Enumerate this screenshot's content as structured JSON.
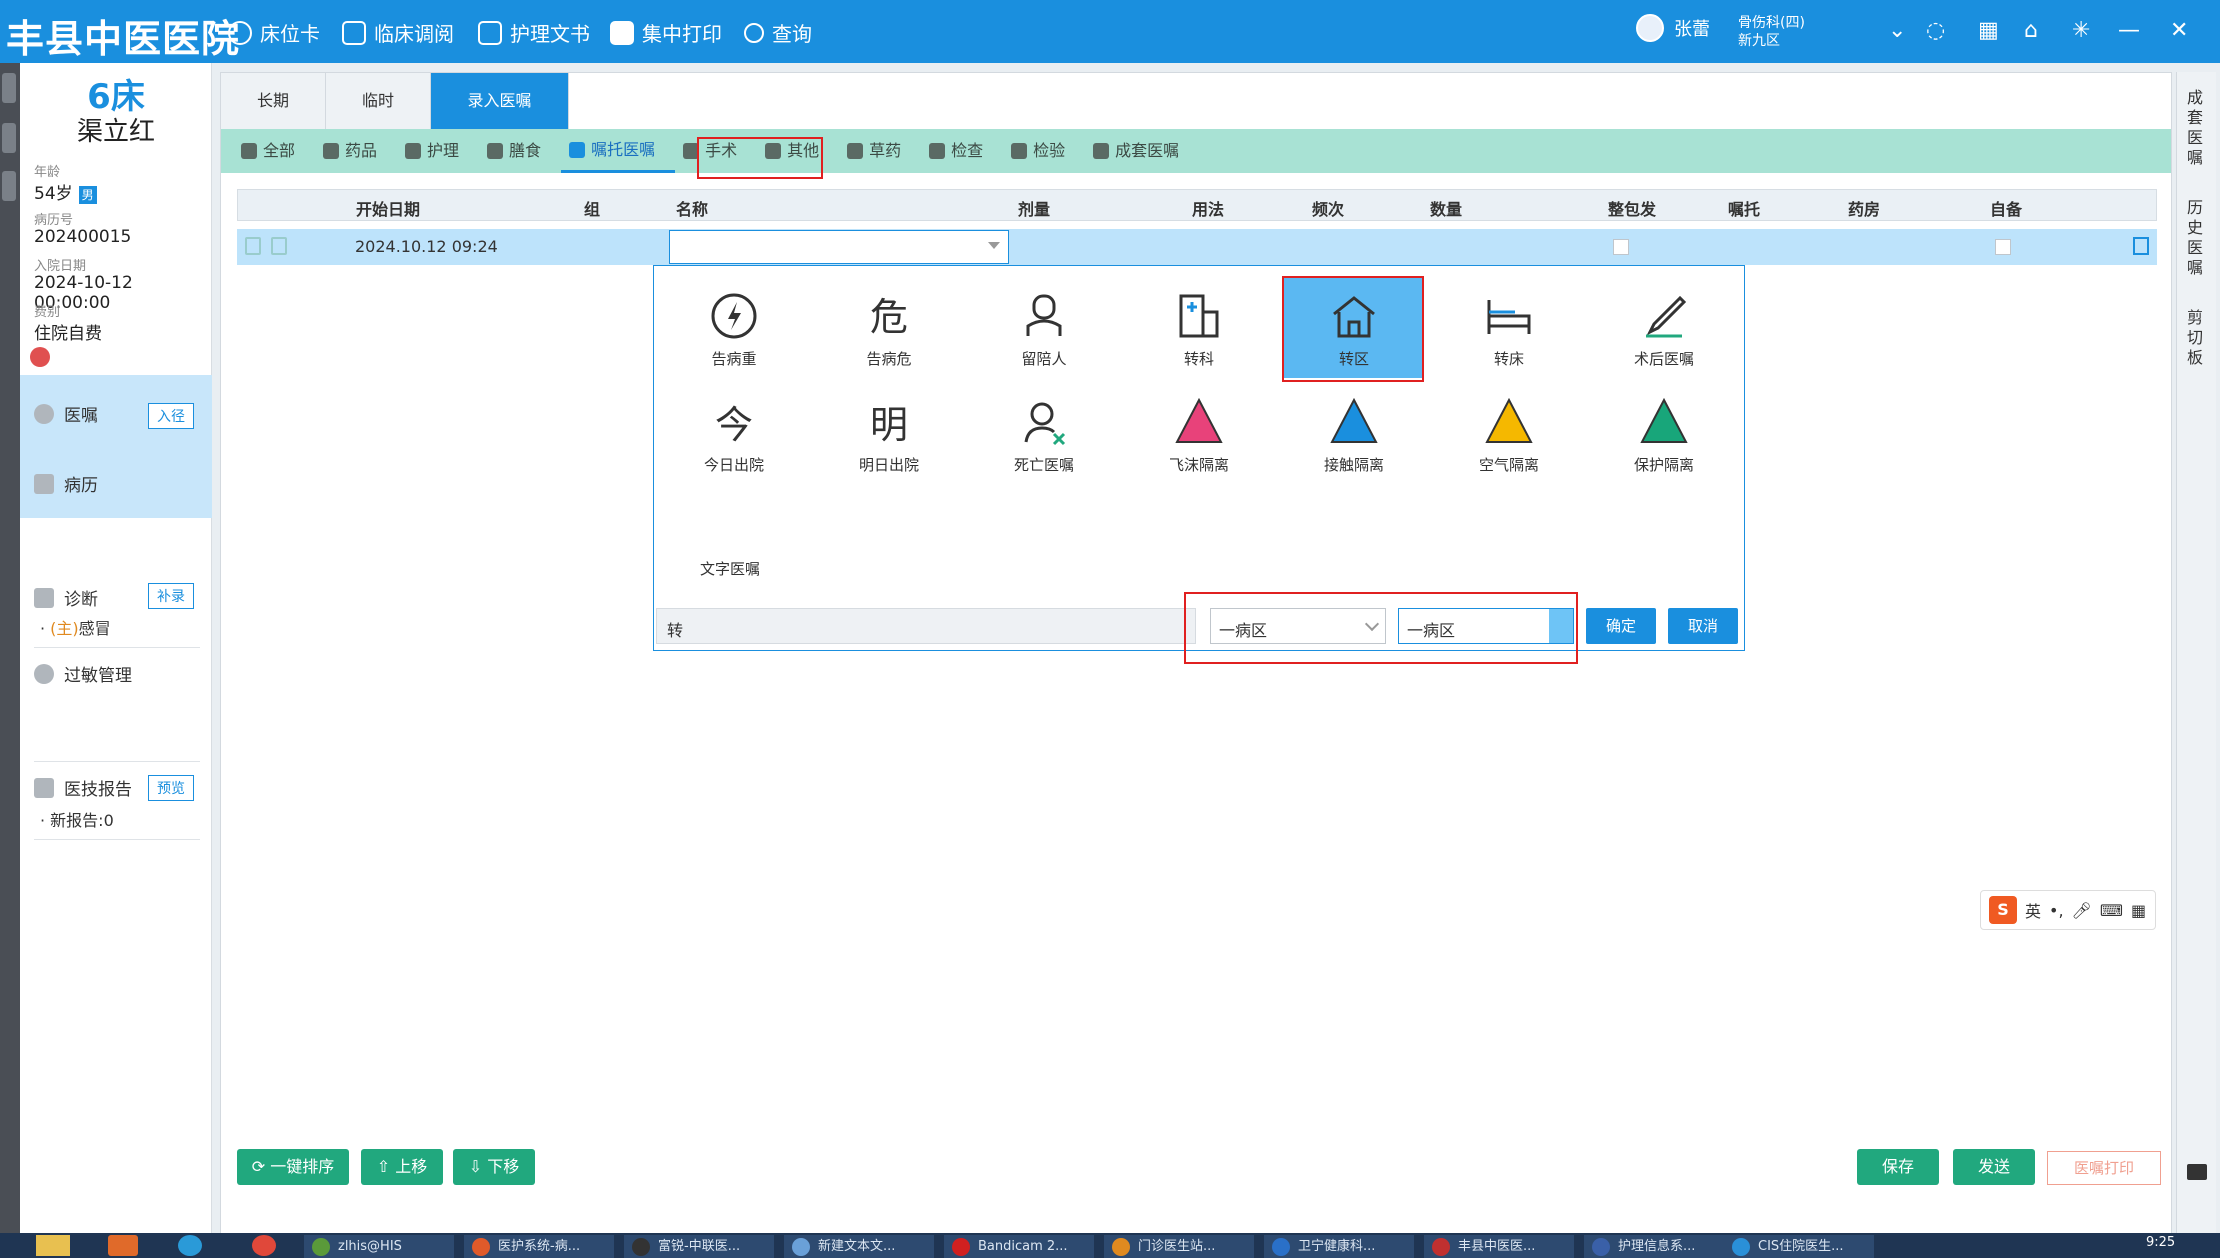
{
  "header": {
    "hospital": "丰县中医医院",
    "nav": [
      {
        "label": "床位卡",
        "icon": "back-circle-icon"
      },
      {
        "label": "临床调阅",
        "icon": "layers-icon"
      },
      {
        "label": "护理文书",
        "icon": "document-icon"
      },
      {
        "label": "集中打印",
        "icon": "printer-icon"
      },
      {
        "label": "查询",
        "icon": "search-icon"
      }
    ],
    "user": "张蕾",
    "dept_line1": "骨伤科(四)",
    "dept_line2": "新九区"
  },
  "patient": {
    "bed": "6床",
    "name": "渠立红",
    "age_label": "年龄",
    "age": "54岁",
    "gender": "男",
    "record_label": "病历号",
    "record_no": "202400015",
    "admit_label": "入院日期",
    "admit_date": "2024-10-12 00:00:00",
    "fee_label": "费别",
    "fee_type": "住院自费"
  },
  "sidebar": {
    "orders": "医嘱",
    "orders_btn": "入径",
    "records": "病历",
    "diagnosis": "诊断",
    "diagnosis_btn": "补录",
    "diagnosis_prefix": "(主)",
    "diagnosis_item": "感冒",
    "allergy": "过敏管理",
    "reports": "医技报告",
    "reports_btn": "预览",
    "new_reports": "新报告:0"
  },
  "tabs": [
    "长期",
    "临时",
    "录入医嘱"
  ],
  "subtabs": [
    "全部",
    "药品",
    "护理",
    "膳食",
    "嘱托医嘱",
    "手术",
    "其他",
    "草药",
    "检查",
    "检验",
    "成套医嘱"
  ],
  "grid": {
    "headers": [
      "开始日期",
      "组",
      "名称",
      "剂量",
      "用法",
      "频次",
      "数量",
      "整包发",
      "嘱托",
      "药房",
      "自备"
    ],
    "row_date": "2024.10.12 09:24"
  },
  "popup": {
    "items_row1": [
      "告病重",
      "告病危",
      "留陪人",
      "转科",
      "转区",
      "转床",
      "术后医嘱"
    ],
    "items_row2": [
      "今日出院",
      "明日出院",
      "死亡医嘱",
      "飞沫隔离",
      "接触隔离",
      "空气隔离",
      "保护隔离"
    ],
    "row2_glyph1": "今",
    "row2_glyph2": "明",
    "row1_glyph2": "危",
    "text_order": "文字医嘱",
    "memo_value": "转",
    "select1": "一病区",
    "select2": "一病区",
    "confirm": "确定",
    "cancel": "取消"
  },
  "bottom": {
    "sort": "一键排序",
    "up": "上移",
    "down": "下移",
    "save": "保存",
    "send": "发送",
    "print": "医嘱打印"
  },
  "rightbar": {
    "set_orders": "成套医嘱",
    "history_orders": "历史医嘱",
    "clipboard": "剪切板"
  },
  "ime": {
    "logo": "S",
    "mode": "英"
  },
  "taskbar": {
    "apps": [
      "zlhis@HIS",
      "医护系统-病...",
      "富锐-中联医...",
      "新建文本文...",
      "Bandicam 2...",
      "门诊医生站...",
      "卫宁健康科...",
      "丰县中医医...",
      "护理信息系...",
      "CIS住院医生..."
    ],
    "clock": "9:25"
  },
  "colors": {
    "primary": "#1a8fde",
    "subtab_bg": "#a8e2d4",
    "selected_row": "#bde3fb",
    "highlight_box": "#e02020",
    "action_green": "#21a87e"
  }
}
